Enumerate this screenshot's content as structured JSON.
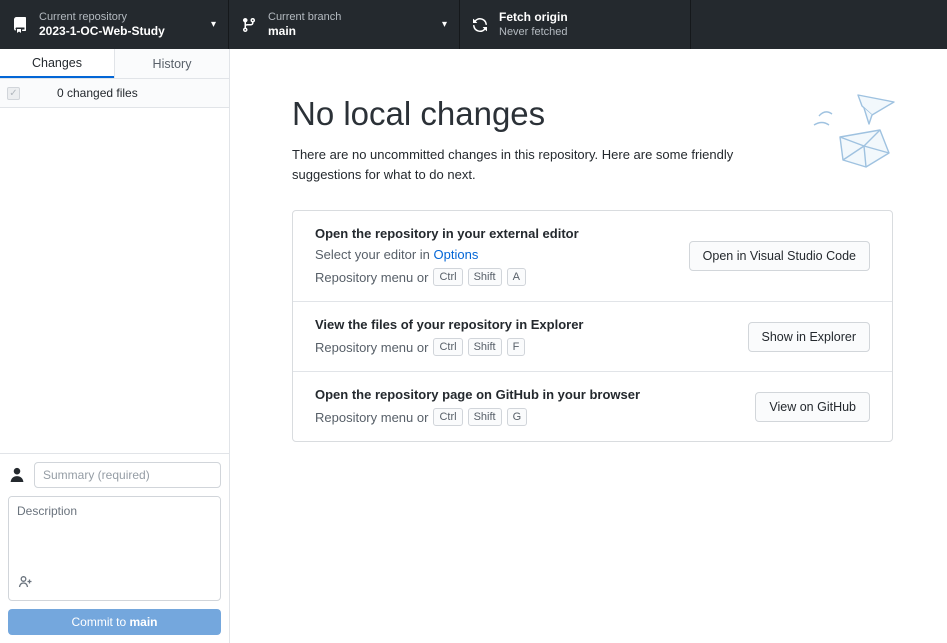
{
  "toolbar": {
    "repository": {
      "label": "Current repository",
      "value": "2023-1-OC-Web-Study"
    },
    "branch": {
      "label": "Current branch",
      "value": "main"
    },
    "fetch": {
      "label": "Fetch origin",
      "status": "Never fetched"
    }
  },
  "sidebar": {
    "tabs": {
      "changes": "Changes",
      "history": "History"
    },
    "changed_files_label": "0 changed files",
    "commit": {
      "summary_placeholder": "Summary (required)",
      "description_placeholder": "Description",
      "button_prefix": "Commit to ",
      "button_branch": "main"
    }
  },
  "main": {
    "title": "No local changes",
    "subtitle": "There are no uncommitted changes in this repository. Here are some friendly suggestions for what to do next.",
    "suggestions": [
      {
        "title": "Open the repository in your external editor",
        "editor_line_prefix": "Select your editor in",
        "editor_link": "Options",
        "menu_prefix": "Repository menu or",
        "keys": [
          "Ctrl",
          "Shift",
          "A"
        ],
        "button": "Open in Visual Studio Code"
      },
      {
        "title": "View the files of your repository in Explorer",
        "menu_prefix": "Repository menu or",
        "keys": [
          "Ctrl",
          "Shift",
          "F"
        ],
        "button": "Show in Explorer"
      },
      {
        "title": "Open the repository page on GitHub in your browser",
        "menu_prefix": "Repository menu or",
        "keys": [
          "Ctrl",
          "Shift",
          "G"
        ],
        "button": "View on GitHub"
      }
    ]
  },
  "icons": {
    "caret": "▾",
    "check": "✓"
  },
  "colors": {
    "toolbar_bg": "#24292e",
    "accent": "#0366d6",
    "commit_button_bg": "#74a7dd",
    "border": "#e1e4e8"
  }
}
